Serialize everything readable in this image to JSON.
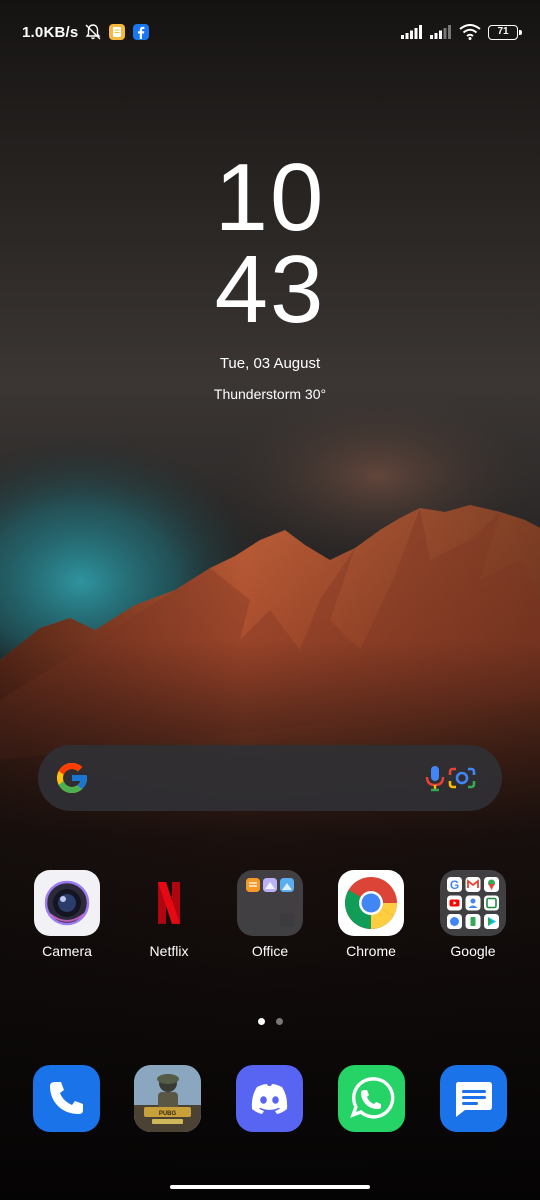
{
  "status_bar": {
    "net_speed": "1.0KB/s",
    "battery_level": "71",
    "left_icons": [
      "bell-off-icon",
      "notes-app-icon",
      "facebook-icon"
    ],
    "right_icons": [
      "signal-sim1-icon",
      "signal-sim2-icon",
      "wifi-icon",
      "battery-icon"
    ]
  },
  "clock": {
    "hours": "10",
    "minutes": "43"
  },
  "date": "Tue, 03 August",
  "weather": "Thunderstorm  30°",
  "search_bar": {
    "icons": [
      "google-g-icon",
      "microphone-icon",
      "google-lens-icon"
    ]
  },
  "apps": [
    {
      "label": "Camera",
      "icon": "camera-icon"
    },
    {
      "label": "Netflix",
      "icon": "netflix-icon"
    },
    {
      "label": "Office",
      "icon": "office-folder-icon"
    },
    {
      "label": "Chrome",
      "icon": "chrome-icon"
    },
    {
      "label": "Google",
      "icon": "google-folder-icon"
    }
  ],
  "page_indicator": {
    "pages": 2,
    "current": 1
  },
  "dock": [
    {
      "icon": "phone-icon"
    },
    {
      "icon": "pubg-icon"
    },
    {
      "icon": "discord-icon"
    },
    {
      "icon": "whatsapp-icon"
    },
    {
      "icon": "messages-icon"
    }
  ],
  "colors": {
    "phone_blue": "#1a73e8",
    "discord": "#5865f2",
    "whatsapp": "#25d366",
    "netflix_red": "#e50914"
  }
}
